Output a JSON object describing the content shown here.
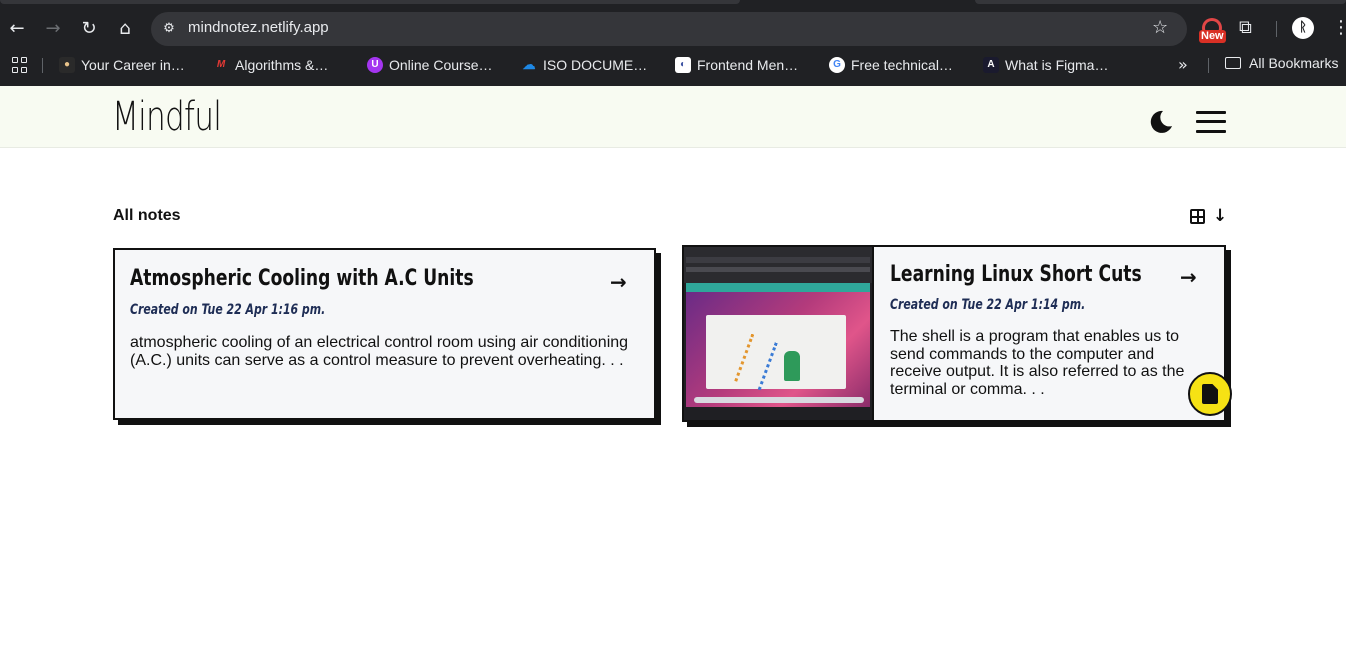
{
  "browser": {
    "url": "mindnotez.netlify.app",
    "new_badge": "New",
    "profile_initial": "ᚱ",
    "bookmarks": [
      {
        "label": "Your Career in…",
        "icon": "career-favicon",
        "color": "#ffffff"
      },
      {
        "label": "Algorithms &…",
        "icon": "algorithms-favicon",
        "color": "#e53935"
      },
      {
        "label": "Online Course…",
        "icon": "udemy-favicon",
        "color": "#a435f0"
      },
      {
        "label": "ISO DOCUME…",
        "icon": "onedrive-favicon",
        "color": "#1e88e5"
      },
      {
        "label": "Frontend Men…",
        "icon": "frontend-mentor-favicon",
        "color": "#ffffff"
      },
      {
        "label": "Free technical…",
        "icon": "google-favicon",
        "color": "#4285f4"
      },
      {
        "label": "What is Figma…",
        "icon": "figma-favicon",
        "color": "#1a1a2e"
      }
    ],
    "all_bookmarks": "All Bookmarks"
  },
  "header": {
    "logo": "Mindful"
  },
  "notes_section": {
    "title": "All notes"
  },
  "notes": [
    {
      "title": "Atmospheric Cooling with A.C Units",
      "created": "Created on Tue 22 Apr 1:16 pm.",
      "description": "atmospheric cooling of an electrical control room using air conditioning (A.C.) units can serve as a control measure to prevent overheating. . .",
      "has_image": false
    },
    {
      "title": "Learning Linux Short Cuts",
      "created": "Created on Tue 22 Apr 1:14 pm.",
      "description": "The shell is a program that enables us to send commands to the computer and receive output. It is also referred to as the terminal or comma. . .",
      "has_image": true
    }
  ],
  "colors": {
    "header_bg": "#f8fbf2",
    "card_bg": "#f6f7f9",
    "date_color": "#1e2d55",
    "fab_bg": "#f6e214"
  }
}
